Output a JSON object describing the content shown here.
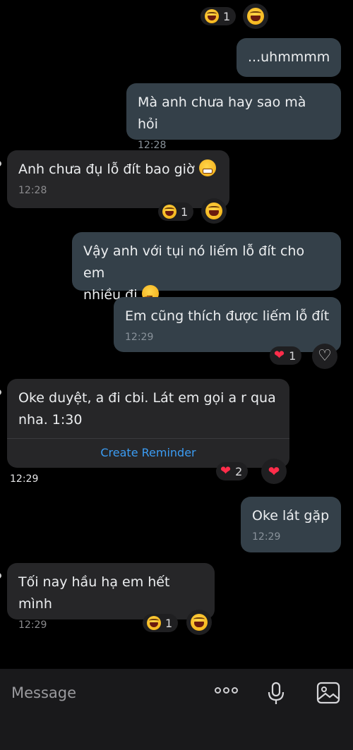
{
  "messages": [
    {
      "id": "m1",
      "direction": "out",
      "text": "...uhmmmm",
      "time": ""
    },
    {
      "id": "m2",
      "direction": "out",
      "text": "Mà anh chưa hay sao mà hỏi",
      "time": "12:28"
    },
    {
      "id": "m3",
      "direction": "in",
      "text": "Anh chưa đụ lỗ đít bao giờ",
      "emoji": "grimacing-face",
      "time": "12:28",
      "reaction": {
        "emoji": "laughing-face",
        "count": "1"
      }
    },
    {
      "id": "m4",
      "direction": "out",
      "text_line1": "Vậy anh với tụi nó liếm lỗ đít cho em",
      "text_line2": "nhiều đi",
      "emoji": "thinking-face",
      "time": ""
    },
    {
      "id": "m5",
      "direction": "out",
      "text": "Em cũng thích được liếm lỗ đít",
      "time": "12:29",
      "reaction": {
        "emoji": "red-heart",
        "count": "1"
      }
    },
    {
      "id": "m6",
      "direction": "in",
      "text_line1": "Oke duyệt, a đi cbi. Lát em gọi a r qua",
      "text_line2": "nha. 1:30",
      "action": "Create Reminder",
      "time": "12:29",
      "reaction": {
        "emoji": "red-heart",
        "count": "2"
      }
    },
    {
      "id": "m7",
      "direction": "out",
      "text": "Oke lát gặp",
      "time": "12:29"
    },
    {
      "id": "m8",
      "direction": "in",
      "text": "Tối nay hầu hạ em hết mình",
      "time": "12:29",
      "reaction": {
        "emoji": "laughing-face",
        "count": "1"
      }
    }
  ],
  "top_reaction": {
    "emoji": "laughing-face",
    "count": "1"
  },
  "composer": {
    "placeholder": "Message"
  },
  "colors": {
    "outgoing_bubble": "#344049",
    "incoming_bubble": "#262628",
    "link": "#3b9cf3",
    "heart": "#ff2d4a"
  }
}
